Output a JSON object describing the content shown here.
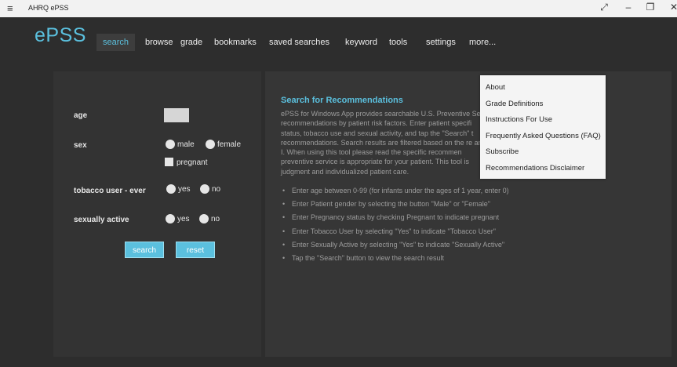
{
  "window": {
    "title": "AHRQ ePSS",
    "hamburger_glyph": "≡",
    "expand_glyph": "⤢",
    "minimize_glyph": "–",
    "restore_glyph": "❐",
    "close_glyph": "✕"
  },
  "brand": "ePSS",
  "nav": {
    "items": [
      "search",
      "browse",
      "grade",
      "bookmarks",
      "saved searches",
      "keyword",
      "tools",
      "settings",
      "more..."
    ],
    "active": "search"
  },
  "form": {
    "age_label": "age",
    "age_value": "",
    "sex_label": "sex",
    "male": "male",
    "female": "female",
    "pregnant": "pregnant",
    "tobacco_label": "tobacco user - ever",
    "sexually_active_label": "sexually active",
    "yes": "yes",
    "no": "no",
    "search_button": "search",
    "reset_button": "reset"
  },
  "content": {
    "heading": "Search for Recommendations",
    "description": "ePSS for Windows App provides searchable U.S. Preventive Se recommendations by patient risk factors. Enter patient specifi status, tobacco use and sexual activity, and tap the \"Search\" t recommendations. Search results are filtered based on the re and I. When using this tool please read the specific recommen preventive service is appropriate for your patient. This tool is judgment and individualized patient care.",
    "bullets": [
      "Enter age between 0-99 (for infants under the ages of 1 year, enter 0)",
      "Enter Patient gender by selecting the button \"Male\" or \"Female\"",
      "Enter Pregnancy status by checking Pregnant to indicate pregnant",
      "Enter Tobacco User by selecting \"Yes\" to indicate \"Tobacco User\"",
      "Enter Sexually Active by selecting \"Yes\" to indicate \"Sexually Active\"",
      "Tap the \"Search\" button to view the search result"
    ],
    "bullet_glyph": "•"
  },
  "more_menu": {
    "items": [
      "About",
      "Grade Definitions",
      "Instructions For Use",
      "Frequently Asked Questions (FAQ)",
      "Subscribe",
      "Recommendations Disclaimer"
    ]
  },
  "colors": {
    "accent": "#5bc0de",
    "background": "#2d2d2d",
    "panel": "#363636"
  }
}
